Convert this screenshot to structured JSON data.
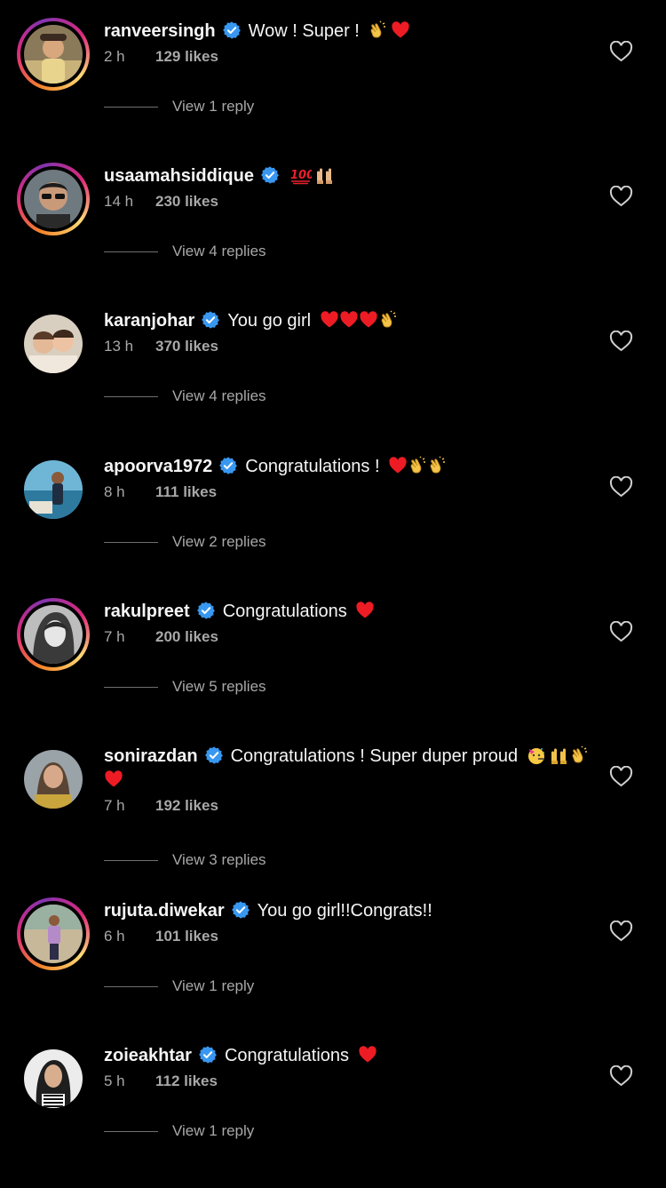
{
  "colors": {
    "background": "#000000",
    "text_primary": "#f5f5f5",
    "text_secondary": "#a8a8a8",
    "verified_badge": "#3897f0",
    "heart_emoji": "#ed1c24"
  },
  "icons": {
    "verified": "verified-badge-icon",
    "like": "heart-outline-icon"
  },
  "comments": [
    {
      "username": "ranveersingh",
      "text": "Wow ! Super !",
      "emojis": [
        "clap",
        "heart"
      ],
      "time": "2 h",
      "likes": "129 likes",
      "replies": "View 1 reply",
      "story_ring": true
    },
    {
      "username": "usaamahsiddique",
      "text": "",
      "emojis": [
        "hundred",
        "raised-hands"
      ],
      "time": "14 h",
      "likes": "230 likes",
      "replies": "View 4 replies",
      "story_ring": true
    },
    {
      "username": "karanjohar",
      "text": "You go girl",
      "emojis": [
        "heart",
        "heart",
        "heart",
        "clap"
      ],
      "time": "13 h",
      "likes": "370 likes",
      "replies": "View 4 replies",
      "story_ring": false
    },
    {
      "username": "apoorva1972",
      "text": "Congratulations !",
      "emojis": [
        "heart",
        "clap",
        "clap"
      ],
      "time": "8 h",
      "likes": "111 likes",
      "replies": "View 2 replies",
      "story_ring": false
    },
    {
      "username": "rakulpreet",
      "text": "Congratulations",
      "emojis": [
        "heart"
      ],
      "time": "7 h",
      "likes": "200 likes",
      "replies": "View 5 replies",
      "story_ring": true
    },
    {
      "username": "sonirazdan",
      "text": "Congratulations ! Super duper proud",
      "emojis": [
        "party-face",
        "raised-hands",
        "clap",
        "heart"
      ],
      "time": "7 h",
      "likes": "192 likes",
      "replies": "View 3 replies",
      "story_ring": false
    },
    {
      "username": "rujuta.diwekar",
      "text": "You go girl!!Congrats!!",
      "emojis": [],
      "time": "6 h",
      "likes": "101 likes",
      "replies": "View 1 reply",
      "story_ring": true
    },
    {
      "username": "zoieakhtar",
      "text": "Congratulations",
      "emojis": [
        "heart"
      ],
      "time": "5 h",
      "likes": "112 likes",
      "replies": "View 1 reply",
      "story_ring": false
    }
  ]
}
